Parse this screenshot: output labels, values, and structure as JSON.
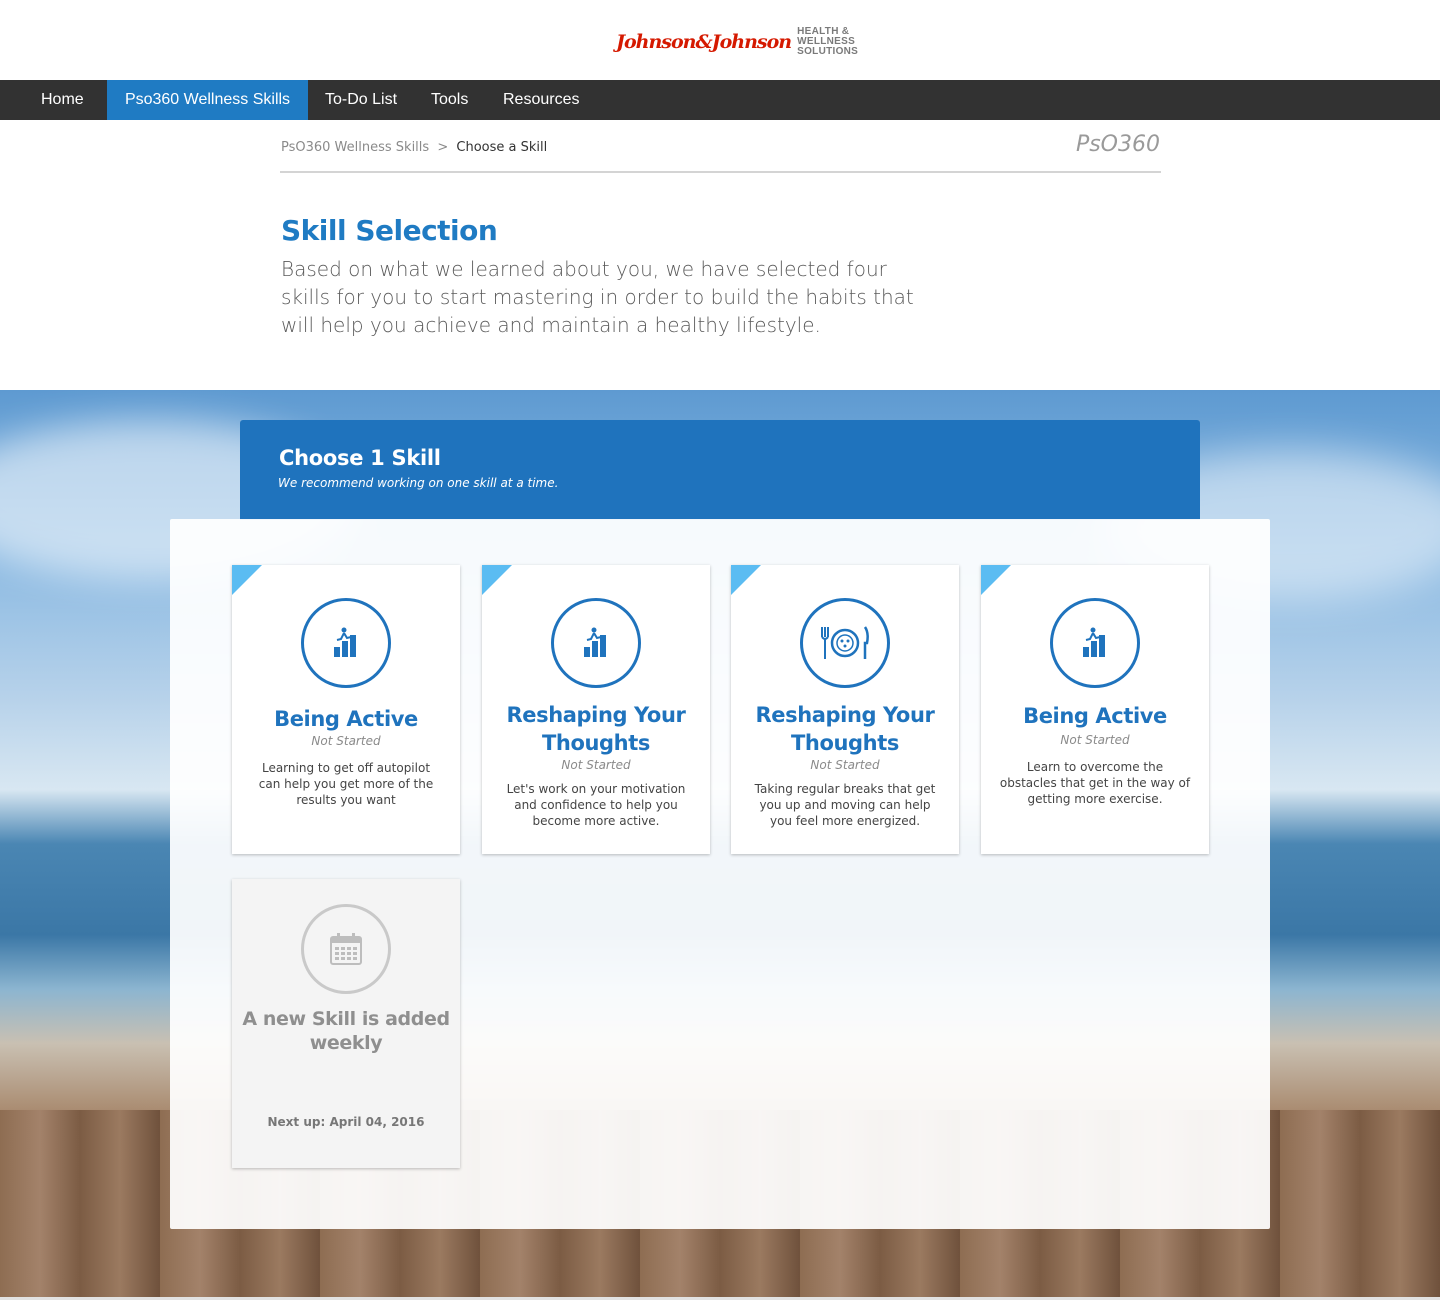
{
  "header": {
    "logo_script": "Johnson&Johnson",
    "logo_sub": "HEALTH &\nWELLNESS\nSOLUTIONS"
  },
  "nav": {
    "items": [
      {
        "label": "Home",
        "active": false
      },
      {
        "label": "Pso360 Wellness Skills",
        "active": true
      },
      {
        "label": "To-Do List",
        "active": false
      },
      {
        "label": "Tools",
        "active": false
      },
      {
        "label": "Resources",
        "active": false
      }
    ]
  },
  "breadcrumb": {
    "parent": "PsO360 Wellness Skills",
    "separator": ">",
    "current": "Choose a Skill",
    "brand": "PsO360"
  },
  "intro": {
    "title": "Skill Selection",
    "text": "Based on what we learned about you, we have selected four skills for you to start mastering in order to build the habits that will help you achieve and maintain a healthy lifestyle."
  },
  "choose": {
    "title": "Choose 1 Skill",
    "subtitle": "We recommend working on one skill at a time."
  },
  "skills": [
    {
      "title": "Being Active",
      "status": "Not Started",
      "description": "Learning to get off autopilot can help you get more of the results you want",
      "icon": "stairs-climber-icon"
    },
    {
      "title": "Reshaping Your Thoughts",
      "status": "Not Started",
      "description": "Let's work on your motivation and confidence to help you become more active.",
      "icon": "stairs-climber-icon"
    },
    {
      "title": "Reshaping Your Thoughts",
      "status": "Not Started",
      "description": "Taking regular breaks that get you up and moving can help you feel more energized.",
      "icon": "plate-utensils-icon"
    },
    {
      "title": "Being Active",
      "status": "Not Started",
      "description": "Learn to overcome the obstacles that get in the way of getting more exercise.",
      "icon": "stairs-climber-icon"
    }
  ],
  "upcoming": {
    "title": "A new Skill is added weekly",
    "next": "Next up: April 04, 2016",
    "icon": "calendar-icon"
  },
  "colors": {
    "primary": "#1f73bd",
    "nav_bg": "#323232",
    "corner_accent": "#5bbcf2",
    "logo_red": "#d51900"
  }
}
